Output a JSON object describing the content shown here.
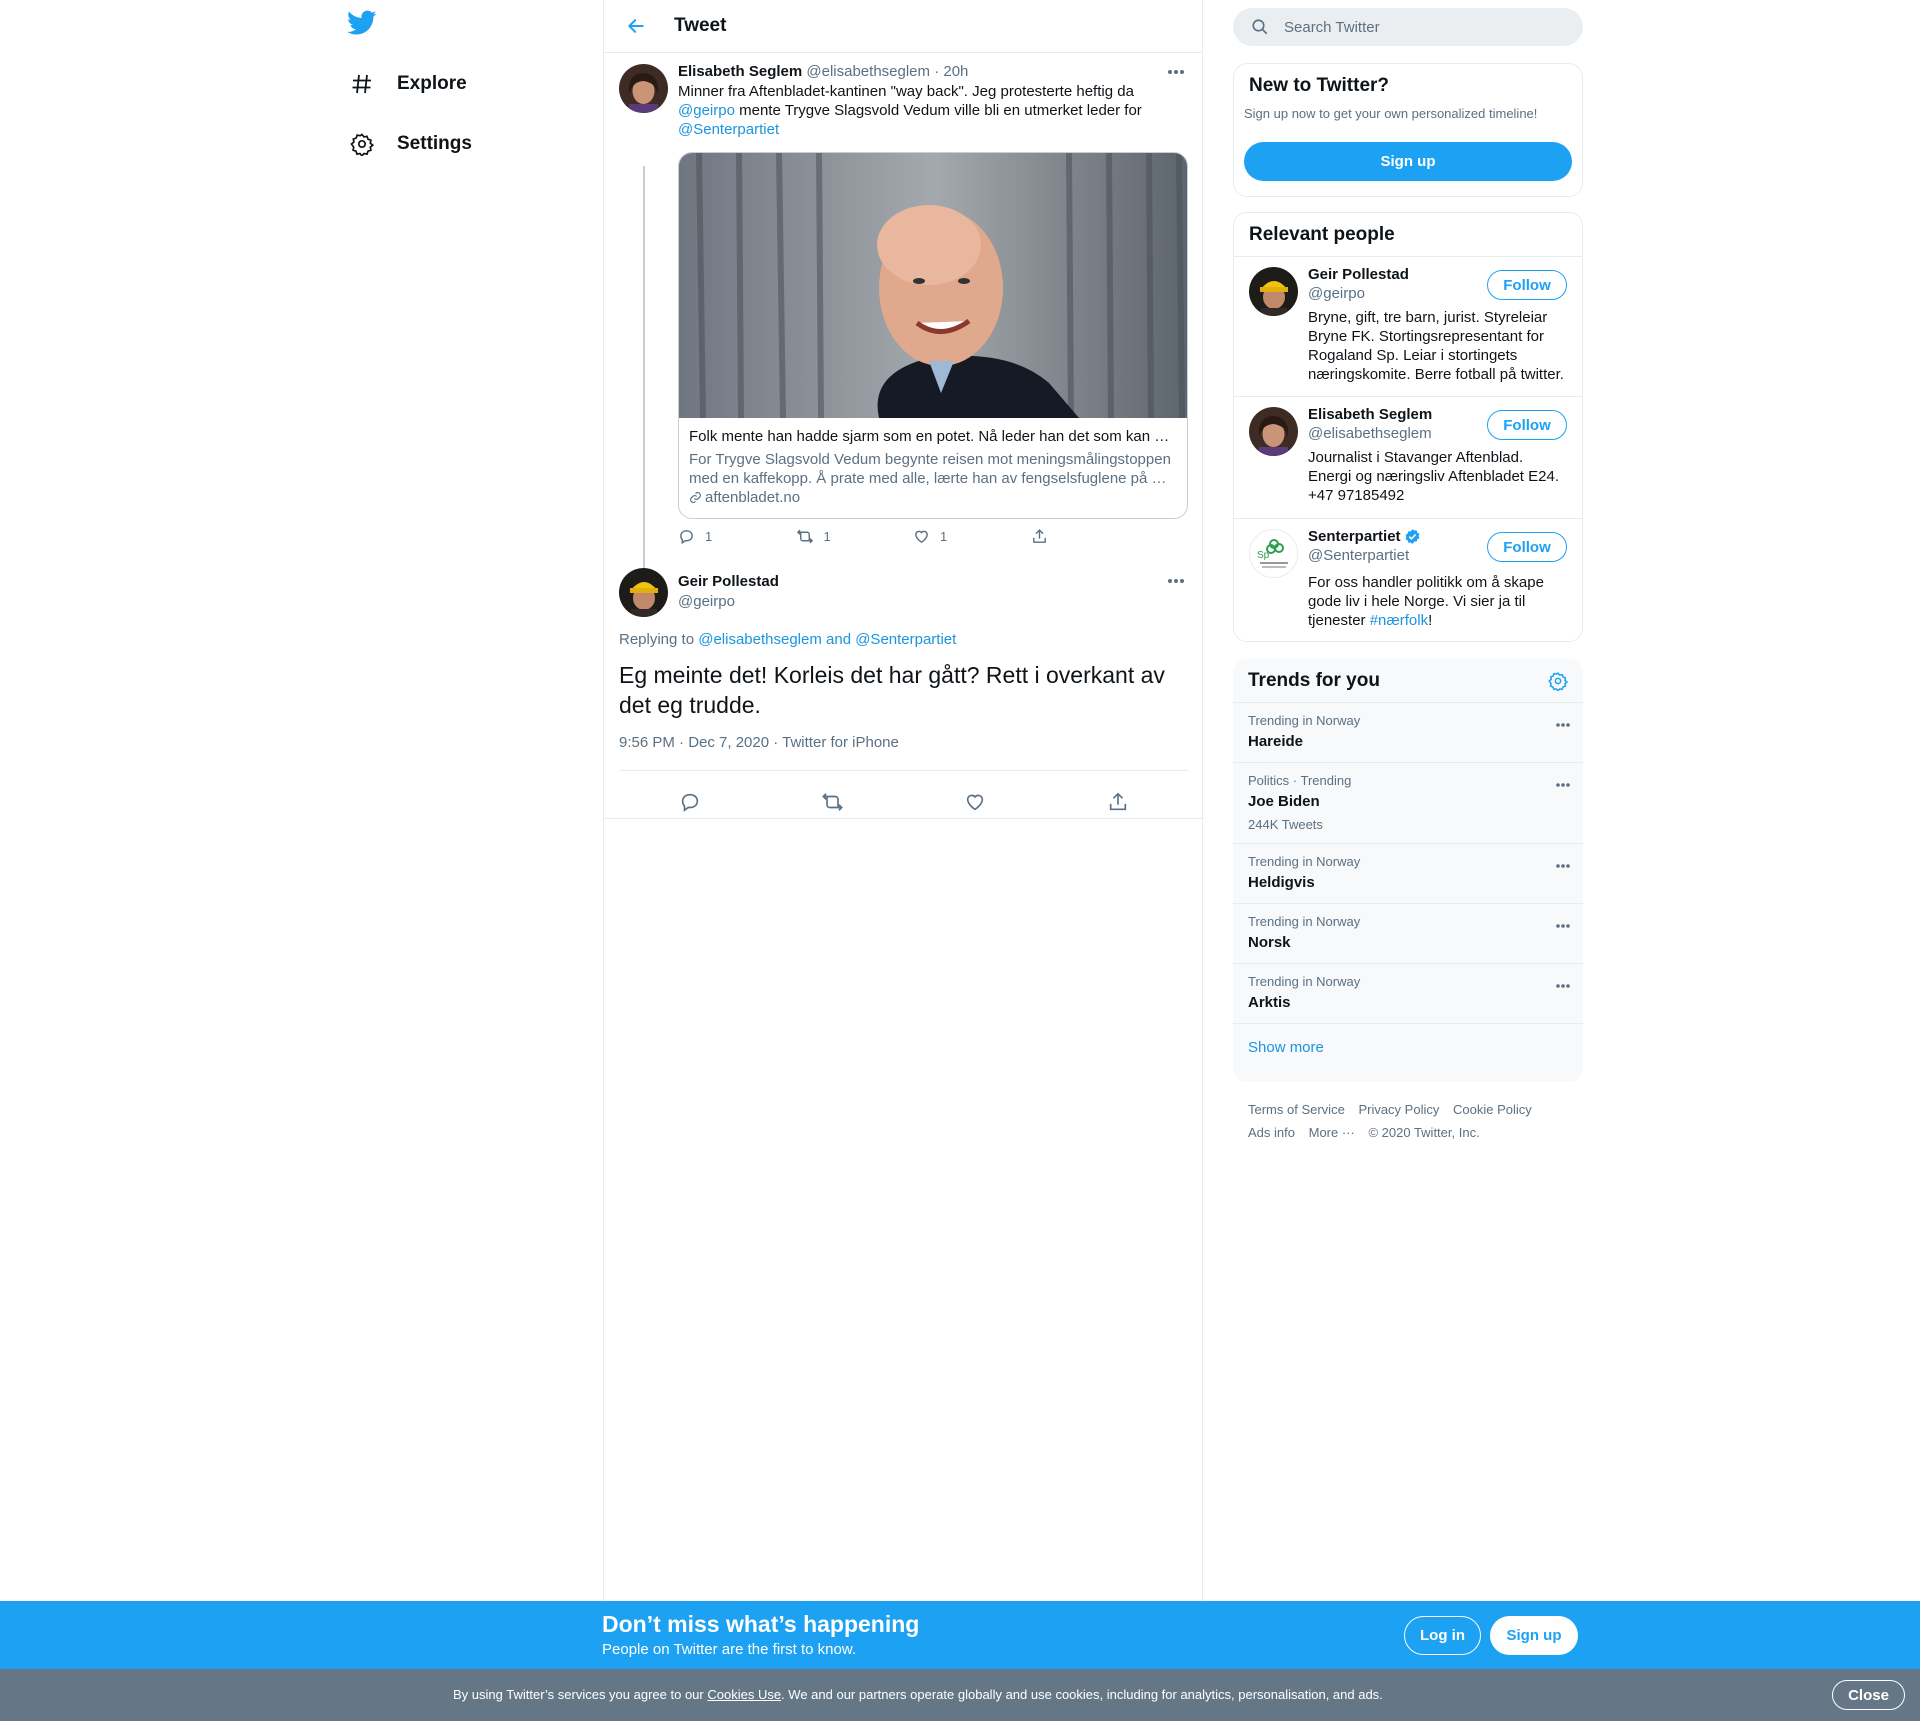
{
  "nav": {
    "logo_icon": "twitter-bird-icon",
    "items": [
      {
        "label": "Explore",
        "icon": "hashtag-icon"
      },
      {
        "label": "Settings",
        "icon": "gear-icon"
      }
    ]
  },
  "header": {
    "title": "Tweet"
  },
  "tweet1": {
    "name": "Elisabeth Seglem",
    "handle": "@elisabethseglem",
    "time": "· 20h",
    "text_part1": "Minner fra Aftenbladet-kantinen \"way back\". Jeg protesterte heftig da",
    "mention1": "@geirpo",
    "text_part2": " mente Trygve Slagsvold Vedum ville bli en utmerket leder for",
    "mention2": "@Senterpartiet",
    "card": {
      "title": "Folk mente han hadde sjarm som en potet. Nå leder han det som kan …",
      "description": "For Trygve Slagsvold Vedum begynte reisen mot meningsmålingstoppen med en kaffekopp. Å prate med alle, lærte han av fengselsfuglene på …",
      "domain": "aftenbladet.no"
    },
    "replies": "1",
    "retweets": "1",
    "likes": "1"
  },
  "tweet2": {
    "name": "Geir Pollestad",
    "handle": "@geirpo",
    "replying_prefix": "Replying to ",
    "replying_to": "@elisabethseglem and @Senterpartiet",
    "text": "Eg meinte det! Korleis det har gått? Rett i overkant av det eg trudde.",
    "meta": "9:56 PM · Dec 7, 2020 · Twitter for iPhone"
  },
  "search": {
    "placeholder": "Search Twitter"
  },
  "new_to_twitter": {
    "title": "New to Twitter?",
    "subtitle": "Sign up now to get your own personalized timeline!",
    "button": "Sign up"
  },
  "relevant_people": {
    "title": "Relevant people",
    "follow_label": "Follow",
    "people": [
      {
        "name": "Geir Pollestad",
        "handle": "@geirpo",
        "bio": "Bryne, gift, tre barn, jurist. Styreleiar Bryne FK. Stortingsrepresentant for Rogaland Sp. Leiar i stortingets næringskomite. Berre fotball på twitter."
      },
      {
        "name": "Elisabeth Seglem",
        "handle": "@elisabethseglem",
        "bio": "Journalist i Stavanger Aftenblad. Energi og næringsliv Aftenbladet E24. +47 97185492"
      },
      {
        "name": "Senterpartiet",
        "handle": "@Senterpartiet",
        "bio_part1": "For oss handler politikk om å skape gode liv i hele Norge. Vi sier ja til tjenester ",
        "bio_hashtag": "#nærfolk",
        "bio_part2": "!",
        "verified": true
      }
    ]
  },
  "trends": {
    "title": "Trends for you",
    "items": [
      {
        "context": "Trending in Norway",
        "name": "Hareide"
      },
      {
        "context": "Politics · Trending",
        "name": "Joe Biden",
        "count": "244K Tweets"
      },
      {
        "context": "Trending in Norway",
        "name": "Heldigvis"
      },
      {
        "context": "Trending in Norway",
        "name": "Norsk"
      },
      {
        "context": "Trending in Norway",
        "name": "Arktis"
      }
    ],
    "show_more": "Show more"
  },
  "footer": {
    "links": [
      "Terms of Service",
      "Privacy Policy",
      "Cookie Policy",
      "Ads info",
      "More ···",
      "© 2020 Twitter, Inc."
    ]
  },
  "banner": {
    "title": "Don’t miss what’s happening",
    "subtitle": "People on Twitter are the first to know.",
    "login": "Log in",
    "signup": "Sign up"
  },
  "cookie": {
    "text_before": "By using Twitter’s services you agree to our ",
    "link": "Cookies Use",
    "text_after": ". We and our partners operate globally and use cookies, including for analytics, personalisation, and ads.",
    "close": "Close"
  },
  "colors": {
    "accent": "#1da1f2",
    "link": "#1b95e0",
    "muted": "#5b7083",
    "cookie_bar": "#657786"
  }
}
